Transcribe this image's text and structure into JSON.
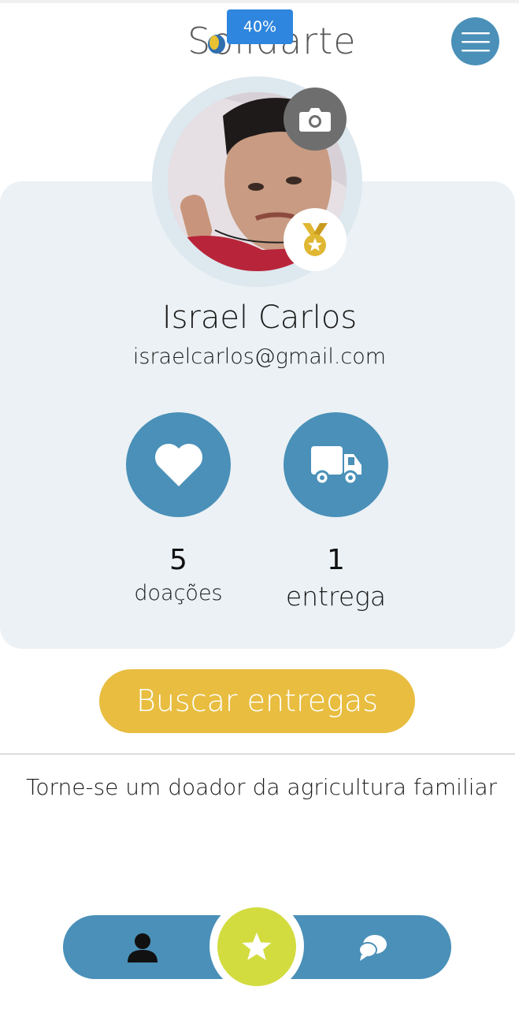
{
  "header": {
    "logo_text": "Solidarte",
    "progress_badge": "40%",
    "menu_icon": "hamburger-icon"
  },
  "profile": {
    "name": "Israel Carlos",
    "email": "israelcarlos@gmail.com",
    "avatar_alt": "profile photo",
    "camera_icon": "camera-icon",
    "medal_icon": "medal-icon"
  },
  "stats": [
    {
      "icon": "heart-icon",
      "value": "5",
      "label": "doações"
    },
    {
      "icon": "truck-icon",
      "value": "1",
      "label": "entrega"
    }
  ],
  "cta": {
    "label": "Buscar entregas"
  },
  "promo": {
    "text": "Torne-se um doador da agricultura familiar"
  },
  "bottom_nav": {
    "left_icon": "user-icon",
    "center_icon": "star-icon",
    "right_icon": "chat-icon"
  },
  "colors": {
    "primary": "#4a90b8",
    "accent_yellow": "#e8bd40",
    "card_bg": "#ebf1f5",
    "nav_center": "#d3dc3f",
    "badge_blue": "#2e86de",
    "medal_gold": "#e0b733"
  }
}
